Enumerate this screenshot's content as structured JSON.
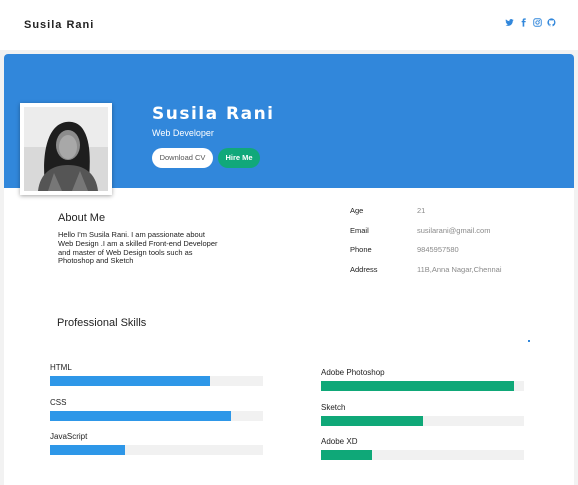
{
  "header": {
    "brand": "Susila Rani",
    "social_icons": [
      "twitter-icon",
      "facebook-icon",
      "instagram-icon",
      "github-icon"
    ],
    "icon_color": "#3187db"
  },
  "hero": {
    "name": "Susila Rani",
    "role": "Web Developer",
    "download_label": "Download CV",
    "hire_label": "Hire Me",
    "background": "#3187db",
    "hire_color": "#11a87a"
  },
  "about": {
    "title": "About Me",
    "text": "Hello I'm Susila Rani. I am passionate about Web Design .I am a skilled Front-end Developer and master of Web Design tools such as Photoshop and Sketch"
  },
  "info": [
    {
      "label": "Age",
      "value": "21"
    },
    {
      "label": "Email",
      "value": "susilarani@gmail.com"
    },
    {
      "label": "Phone",
      "value": "9845957580"
    },
    {
      "label": "Address",
      "value": "11B,Anna Nagar,Chennai"
    }
  ],
  "skills": {
    "title": "Professional Skills",
    "left": [
      {
        "name": "HTML",
        "level": 0.75
      },
      {
        "name": "CSS",
        "level": 0.85
      },
      {
        "name": "JavaScript",
        "level": 0.35
      }
    ],
    "right": [
      {
        "name": "Adobe Photoshop",
        "level": 0.95
      },
      {
        "name": "Sketch",
        "level": 0.5
      },
      {
        "name": "Adobe XD",
        "level": 0.25
      }
    ],
    "left_color": "#2e97e8",
    "right_color": "#0fa878"
  }
}
